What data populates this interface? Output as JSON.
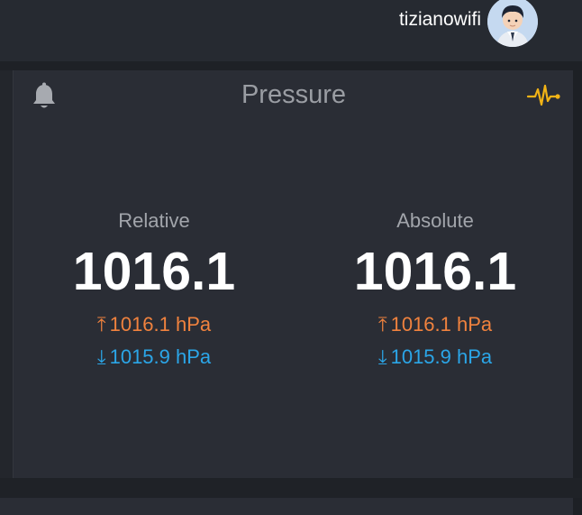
{
  "header": {
    "username": "tizianowifi"
  },
  "card": {
    "title": "Pressure",
    "relative": {
      "label": "Relative",
      "value": "1016.1",
      "max": "1016.1 hPa",
      "min": "1015.9 hPa"
    },
    "absolute": {
      "label": "Absolute",
      "value": "1016.1",
      "max": "1016.1 hPa",
      "min": "1015.9 hPa"
    }
  },
  "icons": {
    "bell": "bell-icon",
    "pulse": "pulse-icon",
    "max_arrow": "⤒",
    "min_arrow": "⤓"
  },
  "colors": {
    "max": "#f0823e",
    "min": "#2ba6e8",
    "pulse": "#f2b316"
  }
}
